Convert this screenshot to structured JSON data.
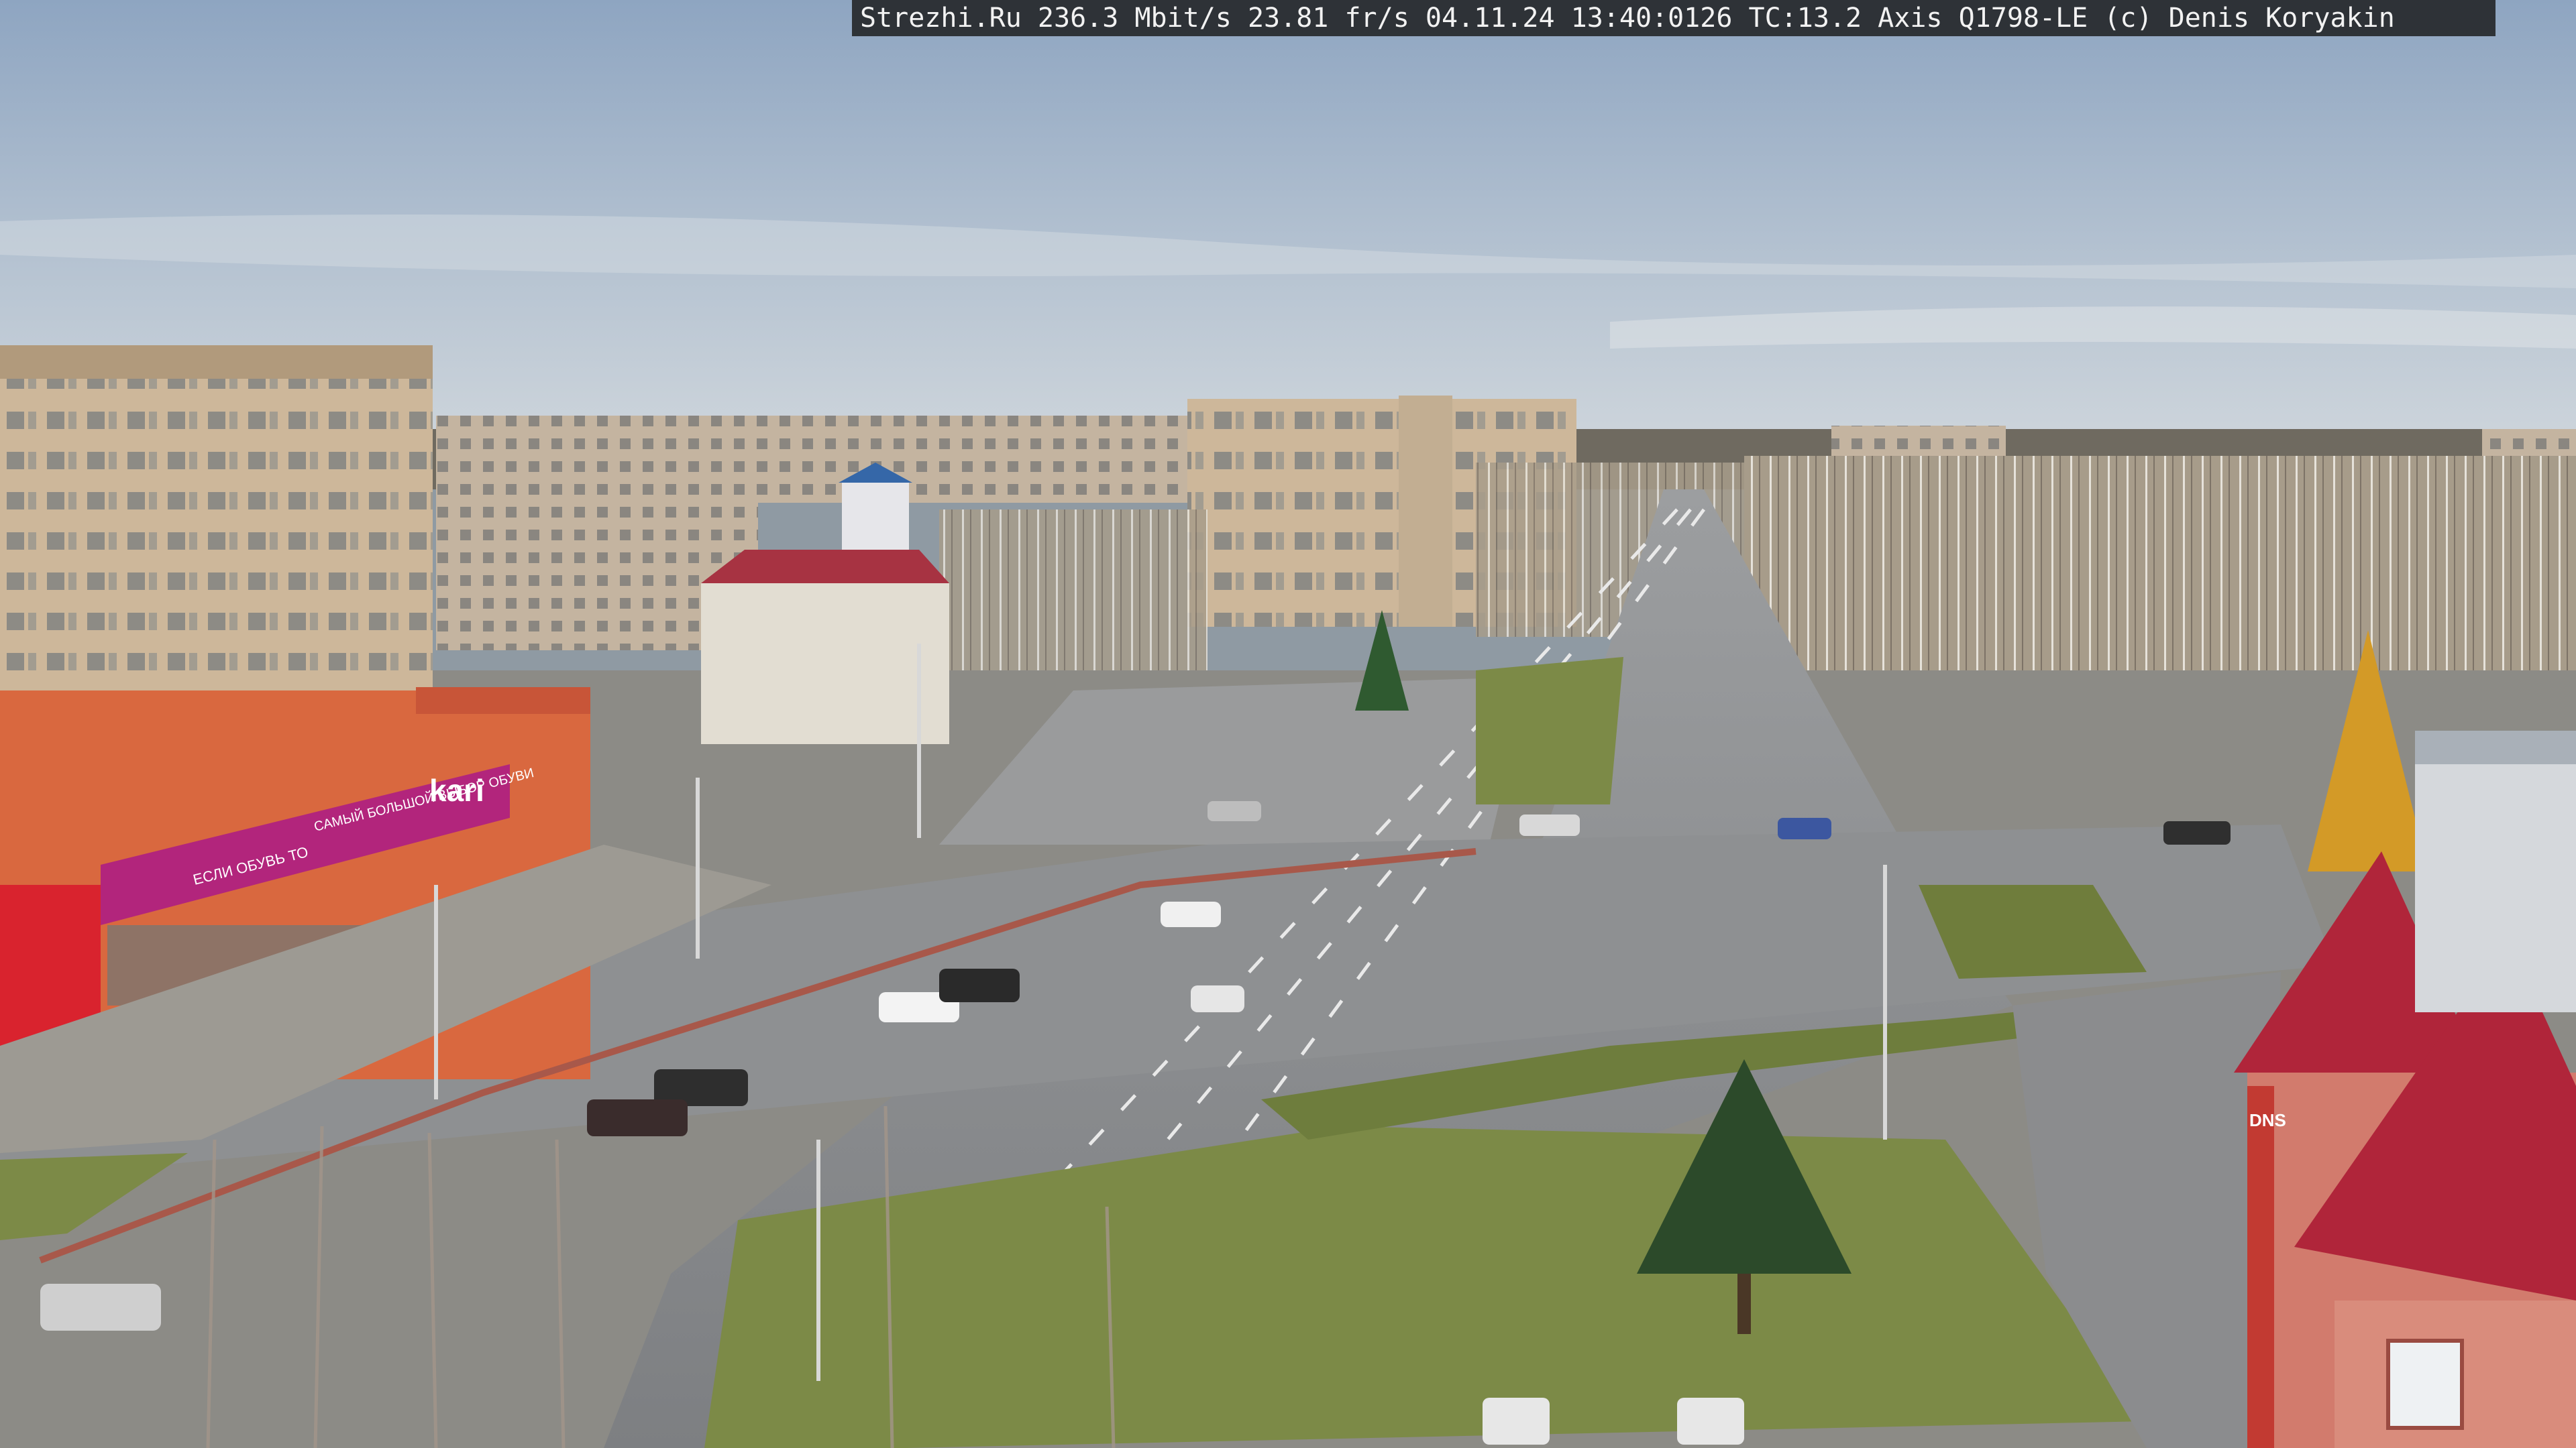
{
  "overlay": {
    "text": "Strezhi.Ru 236.3 Mbit/s 23.81 fr/s 04.11.24 13:40:0126 TC:13.2  Axis Q1798-LE  (c) Denis Koryakin"
  },
  "signs": {
    "store_brand": "kari",
    "store_slogan": "САМЫЙ БОЛЬШОЙ ВЫБОР ОБУВИ",
    "store_tagline": "ЕСЛИ ОБУВЬ ТО",
    "shop_right": "DNS"
  },
  "colors": {
    "sky_top": "#93a9c3",
    "sky_bottom": "#c8d3dc",
    "road": "#8b8d90",
    "grass": "#7c8a47",
    "brand_magenta": "#b2257c",
    "roof_red": "#b0253a"
  }
}
